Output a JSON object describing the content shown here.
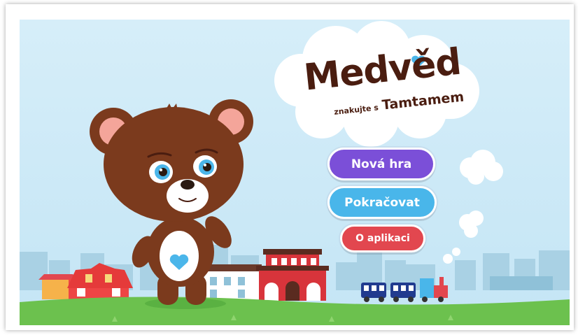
{
  "logo": {
    "title": "Medvěd",
    "subtitle_small": "znakujte s",
    "subtitle_big": "Tamtamem"
  },
  "menu": {
    "new_game": "Nová hra",
    "continue": "Pokračovat",
    "about": "O aplikaci"
  },
  "colors": {
    "sky": "#cfe9f6",
    "grass": "#6cc14e",
    "bear_brown": "#7b3a1d",
    "heart": "#4bb6ea",
    "new_game_button": "#7b4fd8",
    "continue_button": "#49b6ea",
    "about_button": "#e2474f"
  }
}
